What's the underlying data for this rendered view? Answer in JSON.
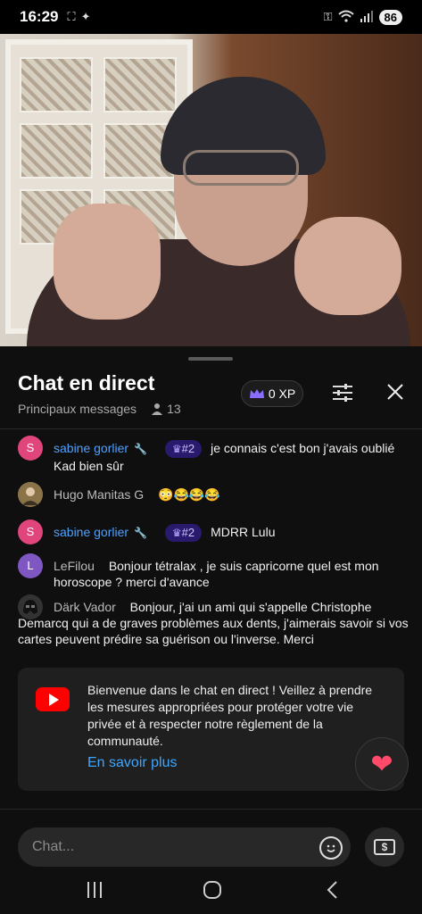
{
  "status_bar": {
    "time": "16:29",
    "battery": "86"
  },
  "chat": {
    "title": "Chat en direct",
    "subtitle": "Principaux messages",
    "viewer_count": "13",
    "xp": "0 XP"
  },
  "messages": [
    {
      "avatar_letter": "S",
      "avatar_color": "#e0457b",
      "author": "sabine gorlier",
      "has_wrench": true,
      "badge": "#2",
      "text": "je connais c'est bon j'avais oublié Kad bien sûr"
    },
    {
      "avatar_letter": "",
      "avatar_color": "#6b5a3a",
      "author": "Hugo Manitas G",
      "has_wrench": false,
      "badge": "",
      "text": "😳😂😂😂"
    },
    {
      "avatar_letter": "S",
      "avatar_color": "#e0457b",
      "author": "sabine gorlier",
      "has_wrench": true,
      "badge": "#2",
      "text": "MDRR Lulu"
    },
    {
      "avatar_letter": "L",
      "avatar_color": "#7e57c2",
      "author": "LeFilou",
      "has_wrench": false,
      "badge": "",
      "text": "Bonjour tétralax , je suis capricorne quel est mon horoscope ? merci d'avance"
    },
    {
      "avatar_letter": "",
      "avatar_color": "#222222",
      "author": "Därk Vador",
      "has_wrench": false,
      "badge": "",
      "text": "Bonjour, j'ai un ami qui s'appelle Christophe Demarcq qui a de graves problèmes aux dents, j'aimerais savoir si vos cartes peuvent prédire sa guérison ou l'inverse. Merci"
    }
  ],
  "notice": {
    "text": "Bienvenue dans le chat en direct ! Veillez à prendre les mesures appropriées pour protéger votre vie privée et à respecter notre règlement de la communauté.",
    "link": "En savoir plus"
  },
  "input": {
    "placeholder": "Chat..."
  },
  "colors": {
    "accent_blue": "#3ea6ff",
    "badge_purple": "#2a1a6e",
    "youtube_red": "#ff0000"
  },
  "icons": [
    "crown-icon",
    "filter-icon",
    "close-icon",
    "person-icon",
    "wrench-icon",
    "youtube-icon",
    "heart-icon",
    "emoji-icon",
    "superchat-icon",
    "recents-icon",
    "home-icon",
    "back-icon"
  ]
}
